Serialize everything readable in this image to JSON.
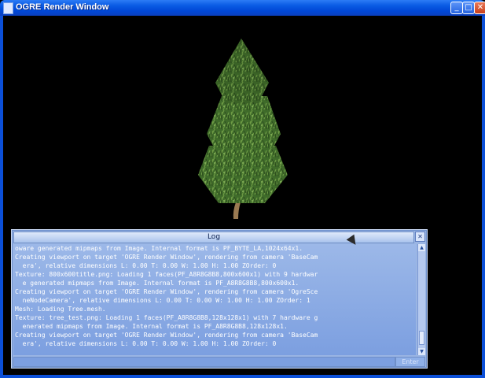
{
  "window": {
    "title": "OGRE Render Window",
    "buttons": {
      "minimize": "_",
      "maximize": "□",
      "close": "✕"
    }
  },
  "log": {
    "title": "Log",
    "close_glyph": "✕",
    "enter_label": "Enter",
    "lines": [
      "oware generated mipmaps from Image. Internal format is PF_BYTE_LA,1024x64x1.",
      "Creating viewport on target 'OGRE Render Window', rendering from camera 'BaseCam",
      "  era', relative dimensions L: 0.00 T: 0.00 W: 1.00 H: 1.00 ZOrder: 0",
      "Texture: 800x600title.png: Loading 1 faces(PF_A8R8G8B8,800x600x1) with 9 hardwar",
      "  e generated mipmaps from Image. Internal format is PF_A8R8G8B8,800x600x1.",
      "Creating viewport on target 'OGRE Render Window', rendering from camera 'OgreSce",
      "  neNodeCamera', relative dimensions L: 0.00 T: 0.00 W: 1.00 H: 1.00 ZOrder: 1",
      "Mesh: Loading Tree.mesh.",
      "Texture: tree_test.png: Loading 1 faces(PF_A8R8G8B8,128x128x1) with 7 hardware g",
      "  enerated mipmaps from Image. Internal format is PF_A8R8G8B8,128x128x1.",
      "Creating viewport on target 'OGRE Render Window', rendering from camera 'BaseCam",
      "  era', relative dimensions L: 0.00 T: 0.00 W: 1.00 H: 1.00 ZOrder: 0"
    ]
  }
}
